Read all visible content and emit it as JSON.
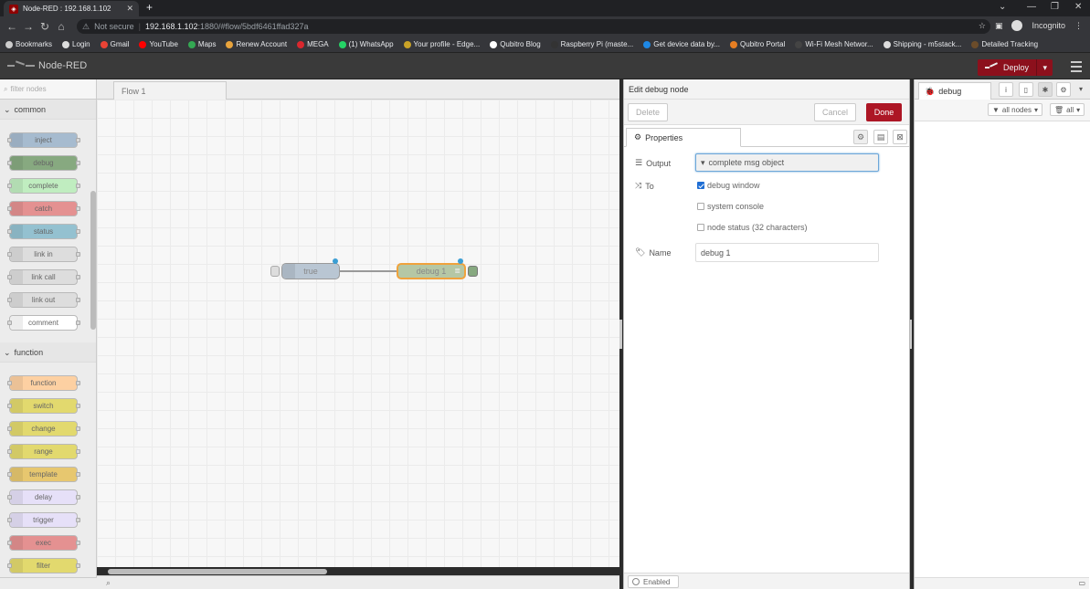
{
  "browser": {
    "tab_title": "Node-RED : 192.168.1.102",
    "tab_close": "✕",
    "new_tab": "+",
    "not_secure": "Not secure",
    "url_host": "192.168.1.102",
    "url_path": ":1880/#flow/5bdf6461ffad327a",
    "profile": "Incognito",
    "bookmarks": [
      {
        "label": "Bookmarks",
        "color": "#cccccc"
      },
      {
        "label": "Login",
        "color": "#dddddd"
      },
      {
        "label": "Gmail",
        "color": "#ea4335"
      },
      {
        "label": "YouTube",
        "color": "#ff0000"
      },
      {
        "label": "Maps",
        "color": "#34a853"
      },
      {
        "label": "Renew Account",
        "color": "#e8a33c"
      },
      {
        "label": "MEGA",
        "color": "#d9272e"
      },
      {
        "label": "(1) WhatsApp",
        "color": "#25d366"
      },
      {
        "label": "Your profile - Edge...",
        "color": "#c9a227"
      },
      {
        "label": "Qubitro Blog",
        "color": "#ffffff"
      },
      {
        "label": "Raspberry Pi (maste...",
        "color": "#333333"
      },
      {
        "label": "Get device data by...",
        "color": "#1e88e5"
      },
      {
        "label": "Qubitro Portal",
        "color": "#e67e22"
      },
      {
        "label": "Wi-Fi Mesh Networ...",
        "color": "#444444"
      },
      {
        "label": "Shipping - m5stack...",
        "color": "#dddddd"
      },
      {
        "label": "Detailed Tracking",
        "color": "#6b4c2a"
      }
    ]
  },
  "header": {
    "app_title": "Node-RED",
    "deploy_label": "Deploy"
  },
  "palette": {
    "filter_placeholder": "filter nodes",
    "categories": [
      "common",
      "function"
    ],
    "common_nodes": [
      {
        "label": "inject",
        "color": "#a6bbcf"
      },
      {
        "label": "debug",
        "color": "#87a980"
      },
      {
        "label": "complete",
        "color": "#c0edc0"
      },
      {
        "label": "catch",
        "color": "#e49191"
      },
      {
        "label": "status",
        "color": "#94c1d0"
      },
      {
        "label": "link in",
        "color": "#dddddd"
      },
      {
        "label": "link call",
        "color": "#dddddd"
      },
      {
        "label": "link out",
        "color": "#dddddd"
      },
      {
        "label": "comment",
        "color": "#ffffff"
      }
    ],
    "function_nodes": [
      {
        "label": "function",
        "color": "#fdd0a2"
      },
      {
        "label": "switch",
        "color": "#e2d96e"
      },
      {
        "label": "change",
        "color": "#e2d96e"
      },
      {
        "label": "range",
        "color": "#e2d96e"
      },
      {
        "label": "template",
        "color": "#e7c76f"
      },
      {
        "label": "delay",
        "color": "#e6e0f8"
      },
      {
        "label": "trigger",
        "color": "#e6e0f8"
      },
      {
        "label": "exec",
        "color": "#e49191"
      },
      {
        "label": "filter",
        "color": "#e2d96e"
      }
    ]
  },
  "workspace": {
    "flow_tab": "Flow 1",
    "node_inject": "true",
    "node_debug": "debug 1"
  },
  "editor": {
    "title": "Edit debug node",
    "delete_label": "Delete",
    "cancel_label": "Cancel",
    "done_label": "Done",
    "properties_tab": "Properties",
    "output_label": "Output",
    "output_value": "complete msg object",
    "to_label": "To",
    "opt_debug_window": "debug window",
    "opt_system_console": "system console",
    "opt_node_status": "node status (32 characters)",
    "name_label": "Name",
    "name_value": "debug 1",
    "enabled_label": "Enabled"
  },
  "sidebar": {
    "tab_label": "debug",
    "filter_nodes": "all nodes",
    "clear_label": "all"
  }
}
